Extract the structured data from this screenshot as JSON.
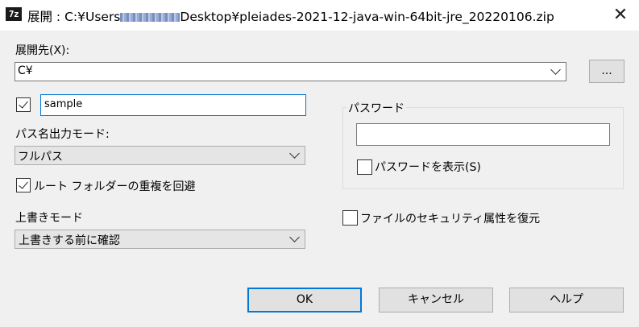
{
  "window": {
    "title_prefix": "展開 : C:¥Users",
    "title_suffix": "Desktop¥pleiades-2021-12-java-win-64bit-jre_20220106.zip",
    "app_icon": "7z",
    "close_glyph": "✕"
  },
  "dest": {
    "label": "展開先(X):",
    "value": "C¥",
    "browse_label": "..."
  },
  "subfolder": {
    "checked": true,
    "value": "sample"
  },
  "path_mode": {
    "label": "パス名出力モード:",
    "value": "フルパス"
  },
  "root_folder": {
    "checked": true,
    "label": "ルート フォルダーの重複を回避"
  },
  "overwrite": {
    "label": "上書きモード",
    "value": "上書きする前に確認"
  },
  "password": {
    "group_label": "パスワード",
    "value": "",
    "show_label": "パスワードを表示(S)",
    "show_checked": false
  },
  "security": {
    "label": "ファイルのセキュリティ属性を復元",
    "checked": false
  },
  "buttons": {
    "ok": "OK",
    "cancel": "キャンセル",
    "help": "ヘルプ"
  },
  "colors": {
    "focus": "#0078d7",
    "dialog_bg": "#f0f0f0"
  }
}
